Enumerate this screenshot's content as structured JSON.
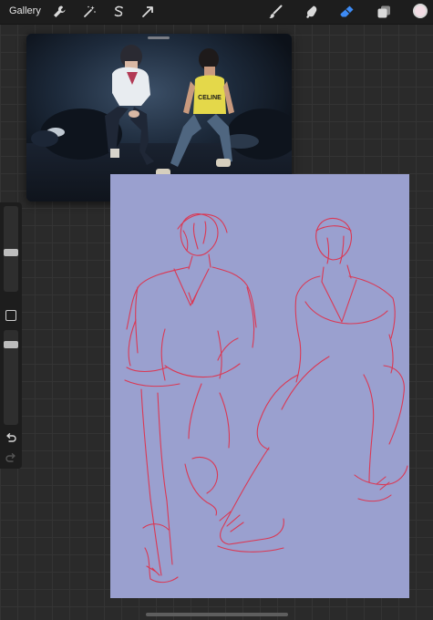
{
  "topbar": {
    "gallery_label": "Gallery",
    "left_tools": [
      "wrench-icon",
      "magic-wand-icon",
      "selection-icon",
      "transform-arrow-icon"
    ],
    "right_tools": [
      "brush-icon",
      "smudge-icon",
      "eraser-icon",
      "layers-icon"
    ],
    "active_tool": "eraser",
    "active_tool_color": "#3d8bf5",
    "current_color": "#f2dce4"
  },
  "sidebar": {
    "brush_size": 0.45,
    "opacity": 0.12
  },
  "reference": {
    "shirt_logo": "CELINE"
  },
  "colors": {
    "canvas": "#9aa0cf",
    "sketch": "#e0304a"
  }
}
